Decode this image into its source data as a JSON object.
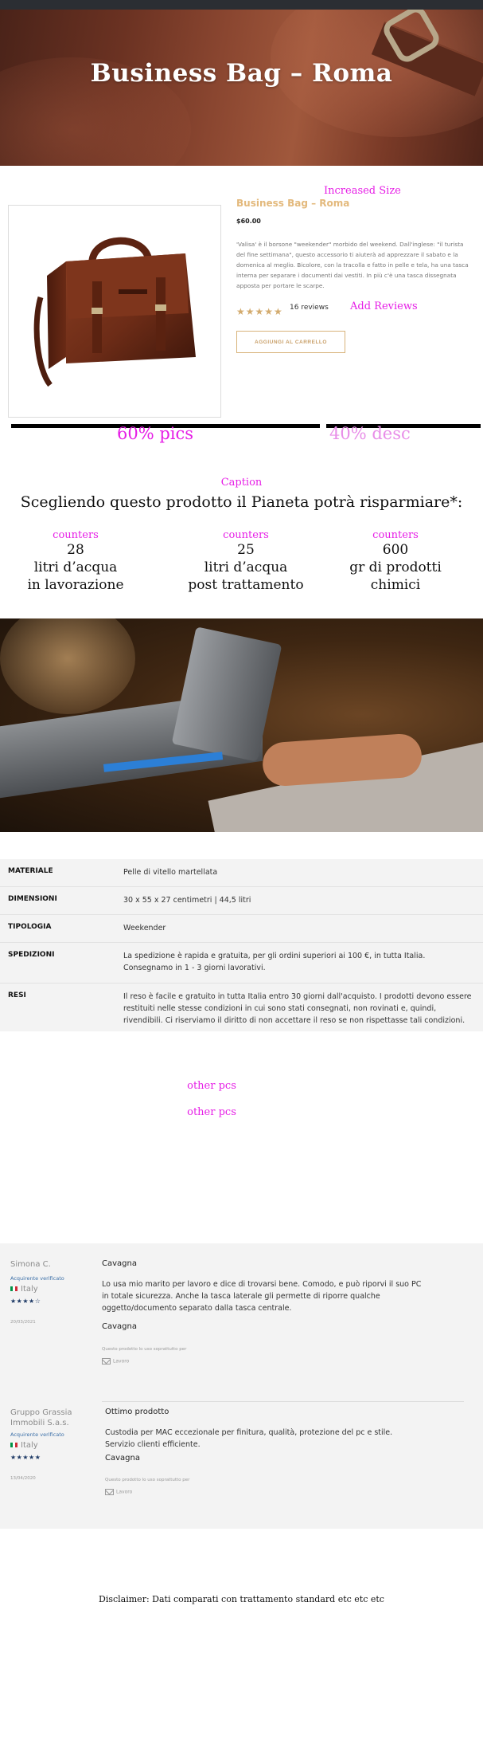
{
  "hero": {
    "title": "Business Bag – Roma"
  },
  "annotations": {
    "increased_size": "Increased Size",
    "add_reviews": "Add Reviews",
    "pics": "60% pics",
    "desc": "40% desc",
    "caption": "Caption",
    "counters": "counters",
    "other_pcs": "other pcs"
  },
  "product": {
    "name": "Business Bag – Roma",
    "price": "$60.00",
    "description": "'Valisa' è il borsone \"weekender\" morbido del weekend. Dall'inglese: \"il turista del fine settimana\", questo accessorio ti aiuterà ad apprezzare il sabato e la domenica al meglio. Bicolore, con la tracolla e fatto in pelle e tela, ha una tasca interna per separare i documenti dai vestiti. In più c'è una tasca dissegnata apposta per portare le scarpe.",
    "rating": 5,
    "stars": "★★★★★",
    "reviews_count": "16 reviews",
    "add_to_cart": "AGGIUNGI AL CARRELLO"
  },
  "savings": {
    "title": "Scegliendo questo prodotto il Pianeta potrà risparmiare*:",
    "counters": [
      {
        "value": "28",
        "label": "litri d’acqua\nin lavorazione"
      },
      {
        "value": "25",
        "label": "litri d’acqua\npost trattamento"
      },
      {
        "value": "600",
        "label": "gr di prodotti\nchimici"
      }
    ]
  },
  "specs": [
    {
      "key": "MATERIALE",
      "value": "Pelle di vitello martellata"
    },
    {
      "key": "DIMENSIONI",
      "value": "30 x 55 x 27 centimetri | 44,5 litri"
    },
    {
      "key": "TIPOLOGIA",
      "value": "Weekender"
    },
    {
      "key": "SPEDIZIONI",
      "value": "La spedizione è rapida e gratuita, per gli ordini superiori ai 100 €, in tutta Italia. Consegnamo in 1 - 3 giorni lavorativi."
    },
    {
      "key": "RESI",
      "value": "Il reso è facile e gratuito in tutta Italia entro 30 giorni dall'acquisto. I prodotti devono essere restituiti nelle stesse condizioni in cui sono stati consegnati, non rovinati e, quindi, rivendibili. Ci riserviamo il diritto di non accettare il reso se non rispettasse tali condizioni."
    }
  ],
  "reviews": [
    {
      "author": "Simona C.",
      "verified": "Acquirente verificato",
      "country": "Italy",
      "rating": 4,
      "stars": "★★★★☆",
      "date": "20/03/2021",
      "title": "Cavagna",
      "body": "Lo usa mio marito per lavoro e dice di trovarsi bene. Comodo, e può riporvi il suo PC in totale sicurezza. Anche la tasca laterale gli permette di riporre qualche oggetto/documento separato dalla tasca centrale.",
      "use_title": "Cavagna",
      "used_for": "Questo prodotto lo uso soprattutto per",
      "use_tag": "Lavoro"
    },
    {
      "author": "Gruppo Grassia Immobili S.a.s.",
      "verified": "Acquirente verificato",
      "country": "Italy",
      "rating": 5,
      "stars": "★★★★★",
      "date": "13/04/2020",
      "title": "Ottimo prodotto",
      "body": "Custodia per MAC eccezionale per finitura, qualità, protezione del pc e stile.\nServizio clienti efficiente.",
      "use_title": "Cavagna",
      "used_for": "Questo prodotto lo uso soprattutto per",
      "use_tag": "Lavoro"
    }
  ],
  "disclaimer": "Disclaimer: Dati comparati con trattamento standard  etc etc etc"
}
